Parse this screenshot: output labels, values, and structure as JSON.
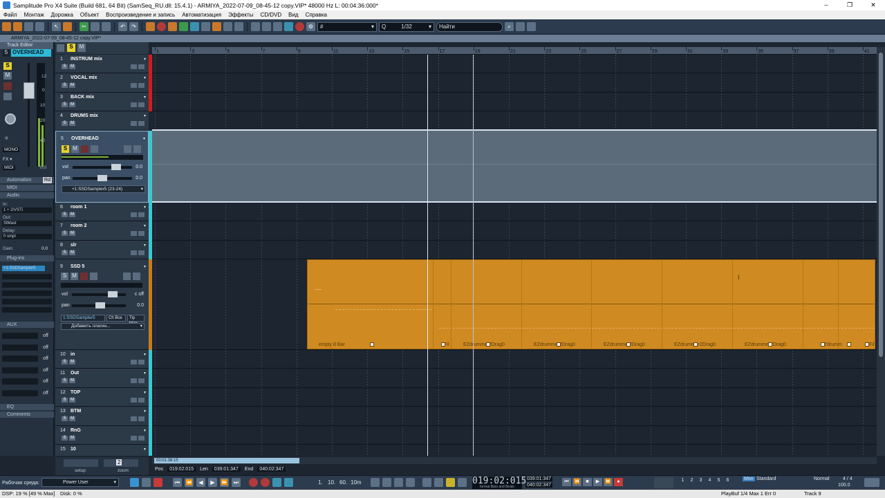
{
  "window": {
    "title": "Samplitude Pro X4 Suite (Build 681, 64 Bit) (SamSeq_RU.dll: 15.4.1)  -  ARMIYA_2022-07-09_08-45-12 copy.VIP*  48000 Hz L: 00:04:36:000*",
    "controls": [
      "–",
      "❐",
      "✕"
    ]
  },
  "menu": [
    "Файл",
    "Монтаж",
    "Дорожка",
    "Объект",
    "Воспроизведение и запись",
    "Автоматизация",
    "Эффекты",
    "CD/DVD",
    "Вид",
    "Справка"
  ],
  "toolbar": {
    "quantize_label": "Q",
    "quantize_value": "1/32",
    "search_placeholder": "Найти",
    "grid_value": "#"
  },
  "project_tab": "ARMIYA_2022-07-09_08-45-12 copy.VIP*",
  "track_editor": {
    "title": "Track Editor",
    "track_num": "5",
    "track_name": "OVERHEAD",
    "fader_scale": [
      "12",
      "0",
      "10",
      "20",
      "40",
      "0.0"
    ],
    "btn_s": "S",
    "btn_m": "M",
    "mono": "MONO",
    "fx": "FX ▾",
    "midi": "MIDI",
    "sections": {
      "automation": "Automation",
      "automation_mode": "Rd",
      "midi": "MIDI",
      "audio": "Audio",
      "plugins": "Plug-ins",
      "aux": "AUX",
      "eq": "EQ",
      "comments": "Comments"
    },
    "audio": {
      "in_label": "In:",
      "in_value": "1 + 2/VSTi",
      "out_label": "Out:",
      "out_value": "StMast",
      "delay_label": "Delay:",
      "delay_value": "0 smpl",
      "gain_label": "Gain:",
      "gain_value": "0.0"
    },
    "plugin_slot": "+1:SSDSampler5",
    "aux_off": [
      "off",
      "off",
      "off",
      "off",
      "off",
      "off"
    ]
  },
  "top_buttons": {
    "s": "S",
    "m": "M"
  },
  "tracks": [
    {
      "num": "1",
      "name": "INSTRUM mix"
    },
    {
      "num": "2",
      "name": "VOCAL mix"
    },
    {
      "num": "3",
      "name": "BACK mix"
    },
    {
      "num": "4",
      "name": "DRUMS mix"
    },
    {
      "num": "5",
      "name": "OVERHEAD",
      "vol_label": "vol",
      "vol_value": "0.0",
      "pan_label": "pan",
      "pan_value": "0.0",
      "device": "+1:SSDSampler5 (23-24)"
    },
    {
      "num": "6",
      "name": "room 1"
    },
    {
      "num": "7",
      "name": "room 2"
    },
    {
      "num": "8",
      "name": "slr"
    },
    {
      "num": "9",
      "name": "SSD 5",
      "vol_label": "vol",
      "vol_value": "c off",
      "pan_label": "pan",
      "pan_value": "0.0",
      "device": "1:SSDSampler5",
      "ch": "Ch Bce",
      "tip": "Tip Map",
      "add_plugin": "Добавить плагин..."
    },
    {
      "num": "10",
      "name": "in"
    },
    {
      "num": "11",
      "name": "Out"
    },
    {
      "num": "12",
      "name": "TOP"
    },
    {
      "num": "13",
      "name": "BTM"
    },
    {
      "num": "14",
      "name": "RnG"
    },
    {
      "num": "15",
      "name": "10"
    }
  ],
  "ruler": [
    "1",
    "3",
    "5",
    "7",
    "9",
    "11",
    "13",
    "15",
    "17",
    "19",
    "21",
    "23",
    "25",
    "27",
    "29",
    "31",
    "33",
    "35",
    "37",
    "39",
    "41"
  ],
  "objects": {
    "labels": [
      "empty 8 Bar",
      "Fil",
      "EZdrummer2Drag0",
      "EZdrummer2Drag0",
      "EZdrummer2Drag0",
      "EZdrummer2Drag0",
      "EZdrummer2Drag0",
      "EZdrumm",
      "Fil"
    ]
  },
  "bottom_left": {
    "setup": "setup",
    "zoom": "zoom",
    "zoom_value": "2"
  },
  "hscroll_time": "00:01:38:15",
  "position": {
    "pos_label": "Pos",
    "pos_value": "019:02:015",
    "len_label": "Len",
    "len_value": "039:01:347",
    "end_label": "End",
    "end_value": "040:02:347"
  },
  "status": {
    "workspace_label": "Рабочая среда:",
    "workspace_value": "Power User",
    "snap_values": [
      "1.",
      "10.",
      "60.",
      "10m"
    ],
    "timecode": "019:02:015",
    "timecode_sub": "format",
    "timecode_sub2": "Bars and Beats",
    "loop_l": "039:01:347",
    "loop_e": "040:02:347",
    "mon": "Mon",
    "standard": "Standard",
    "normal": "Normal",
    "meter": "4 / 4",
    "tempo": "100.0",
    "channels": [
      "1",
      "2",
      "3",
      "4",
      "5",
      "6"
    ]
  },
  "footer": {
    "dsp": "DSP: 19 %  [49 % Max]",
    "disk": "Disk:  0 %",
    "playbuf": "PlayBuf 1/4  Max 1  Err 0",
    "track": "Track 9"
  }
}
